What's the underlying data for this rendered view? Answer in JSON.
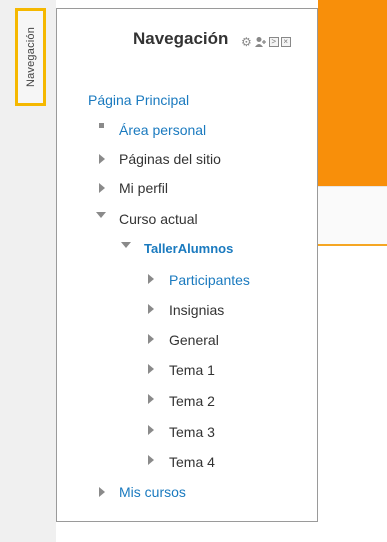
{
  "dock": {
    "tab_label": "Navegación"
  },
  "block": {
    "title": "Navegación",
    "icons": [
      "gear-icon",
      "person-add-icon",
      "dock-to-side-icon",
      "close-icon"
    ]
  },
  "nav": {
    "home": "Página Principal",
    "area_personal": "Área personal",
    "paginas_sitio": "Páginas del sitio",
    "mi_perfil": "Mi perfil",
    "curso_actual": "Curso actual",
    "course": "TallerAlumnos",
    "participantes": "Participantes",
    "insignias": "Insignias",
    "general": "General",
    "tema1": "Tema 1",
    "tema2": "Tema 2",
    "tema3": "Tema 3",
    "tema4": "Tema 4",
    "mis_cursos": "Mis cursos"
  },
  "colors": {
    "accent_orange": "#f88f0a",
    "highlight_yellow": "#f5b800",
    "link_blue": "#1a7abf"
  }
}
